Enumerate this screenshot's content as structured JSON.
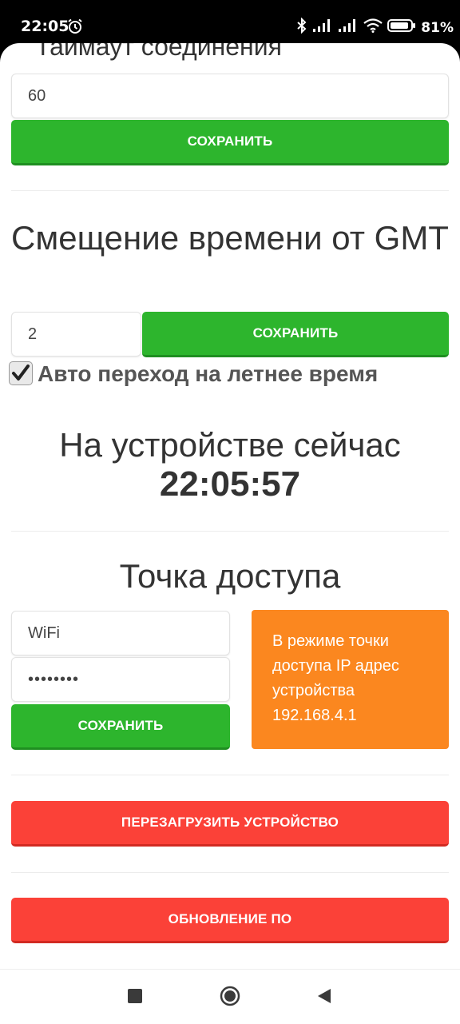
{
  "status_bar": {
    "time": "22:05",
    "battery_percent": "81%"
  },
  "connection_timeout": {
    "title_partial": "Таймаут соединения",
    "value": "60",
    "save_label": "СОХРАНИТЬ"
  },
  "gmt_offset": {
    "title": "Смещение времени от GMT",
    "value": "2",
    "save_label": "СОХРАНИТЬ",
    "dst_checked": true,
    "dst_label": "Авто переход на летнее время"
  },
  "device_time": {
    "label": "На устройстве сейчас",
    "time": "22:05:57"
  },
  "access_point": {
    "title": "Точка доступа",
    "ssid": "WiFi",
    "password_masked": "••••••••",
    "save_label": "СОХРАНИТЬ",
    "info": "В режиме точки доступа IP адрес устройства 192.168.4.1"
  },
  "actions": {
    "reboot_label": "ПЕРЕЗАГРУЗИТЬ УСТРОЙСТВО",
    "update_label": "ОБНОВЛЕНИЕ ПО"
  },
  "colors": {
    "save_green": "#2db52d",
    "danger_red": "#fb4138",
    "info_orange": "#fb871f"
  },
  "icons": [
    "alarm-icon",
    "bluetooth-icon",
    "signal-icon",
    "wifi-icon",
    "battery-icon",
    "checkmark-icon",
    "recents-icon",
    "home-icon",
    "back-icon"
  ]
}
